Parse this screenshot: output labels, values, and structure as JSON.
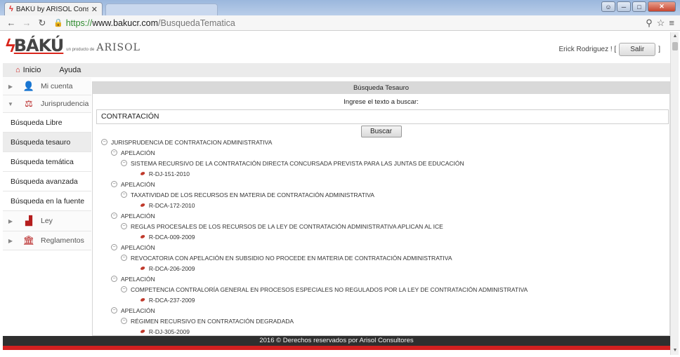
{
  "browser": {
    "tab_title": "BÁKÚ by ARISOL Consulto",
    "tab_close": "✕",
    "url_scheme": "https://",
    "url_host": "www.bakucr.com",
    "url_path": "/BusquedaTematica"
  },
  "header": {
    "logo_word": "BÁKÚ",
    "logo_tagline": "un producto de",
    "logo_company": "ARISOL",
    "user_prefix": "Erick Rodriguez ! [",
    "logout_label": "Salir",
    "user_suffix": "]"
  },
  "topnav": {
    "home_label": "Inicio",
    "help_label": "Ayuda"
  },
  "sidebar": {
    "account": "Mi cuenta",
    "jurisprudence": "Jurisprudencia",
    "links": [
      "Búsqueda Libre",
      "Búsqueda tesauro",
      "Búsqueda temática",
      "Búsqueda avanzada",
      "Búsqueda en la fuente"
    ],
    "law": "Ley",
    "regulations": "Reglamentos"
  },
  "panel": {
    "title": "Búsqueda Tesauro",
    "prompt": "Ingrese el texto a buscar:",
    "search_value": "CONTRATACIÓN",
    "search_button": "Buscar"
  },
  "tree": {
    "root": "JURISPRUDENCIA DE CONTRATACION ADMINISTRATIVA",
    "groups": [
      {
        "label": "APELACIÓN",
        "topic": "SISTEMA RECURSIVO DE LA CONTRATACIÓN DIRECTA CONCURSADA PREVISTA PARA LAS JUNTAS DE EDUCACIÓN",
        "doc": "R-DJ-151-2010"
      },
      {
        "label": "APELACIÓN",
        "topic": "TAXATIVIDAD DE LOS RECURSOS EN MATERIA DE CONTRATACIÓN ADMINISTRATIVA",
        "doc": "R-DCA-172-2010"
      },
      {
        "label": "APELACIÓN",
        "topic": "REGLAS PROCESALES DE LOS RECURSOS DE LA LEY DE CONTRATACIÓN ADMINISTRATIVA APLICAN AL ICE",
        "doc": "R-DCA-009-2009"
      },
      {
        "label": "APELACIÓN",
        "topic": "REVOCATORIA CON APELACIÓN EN SUBSIDIO NO PROCEDE EN MATERIA DE CONTRATACIÓN ADMINISTRATIVA",
        "doc": "R-DCA-206-2009"
      },
      {
        "label": "APELACIÓN",
        "topic": "COMPETENCIA CONTRALORÍA GENERAL  EN PROCESOS ESPECIALES NO REGULADOS POR LA LEY DE CONTRATACIÓN ADMINISTRATIVA",
        "doc": "R-DCA-237-2009"
      },
      {
        "label": "APELACIÓN",
        "topic": "RÉGIMEN RECURSIVO EN CONTRATACIÓN DEGRADADA",
        "doc": "R-DJ-305-2009"
      }
    ]
  },
  "footer": {
    "text": "2016 © Derechos reservados por Arisol Consultores"
  },
  "colors": {
    "brand_red": "#d32020",
    "footer_bg": "#2f2f2f",
    "panel_header_bg": "#d9d9d9"
  },
  "icons": {
    "home": "home-icon",
    "account": "user-icon",
    "jurisprudence": "gavel-book-icon",
    "law": "podium-icon",
    "regulations": "institution-icon",
    "document": "document-link-icon"
  }
}
